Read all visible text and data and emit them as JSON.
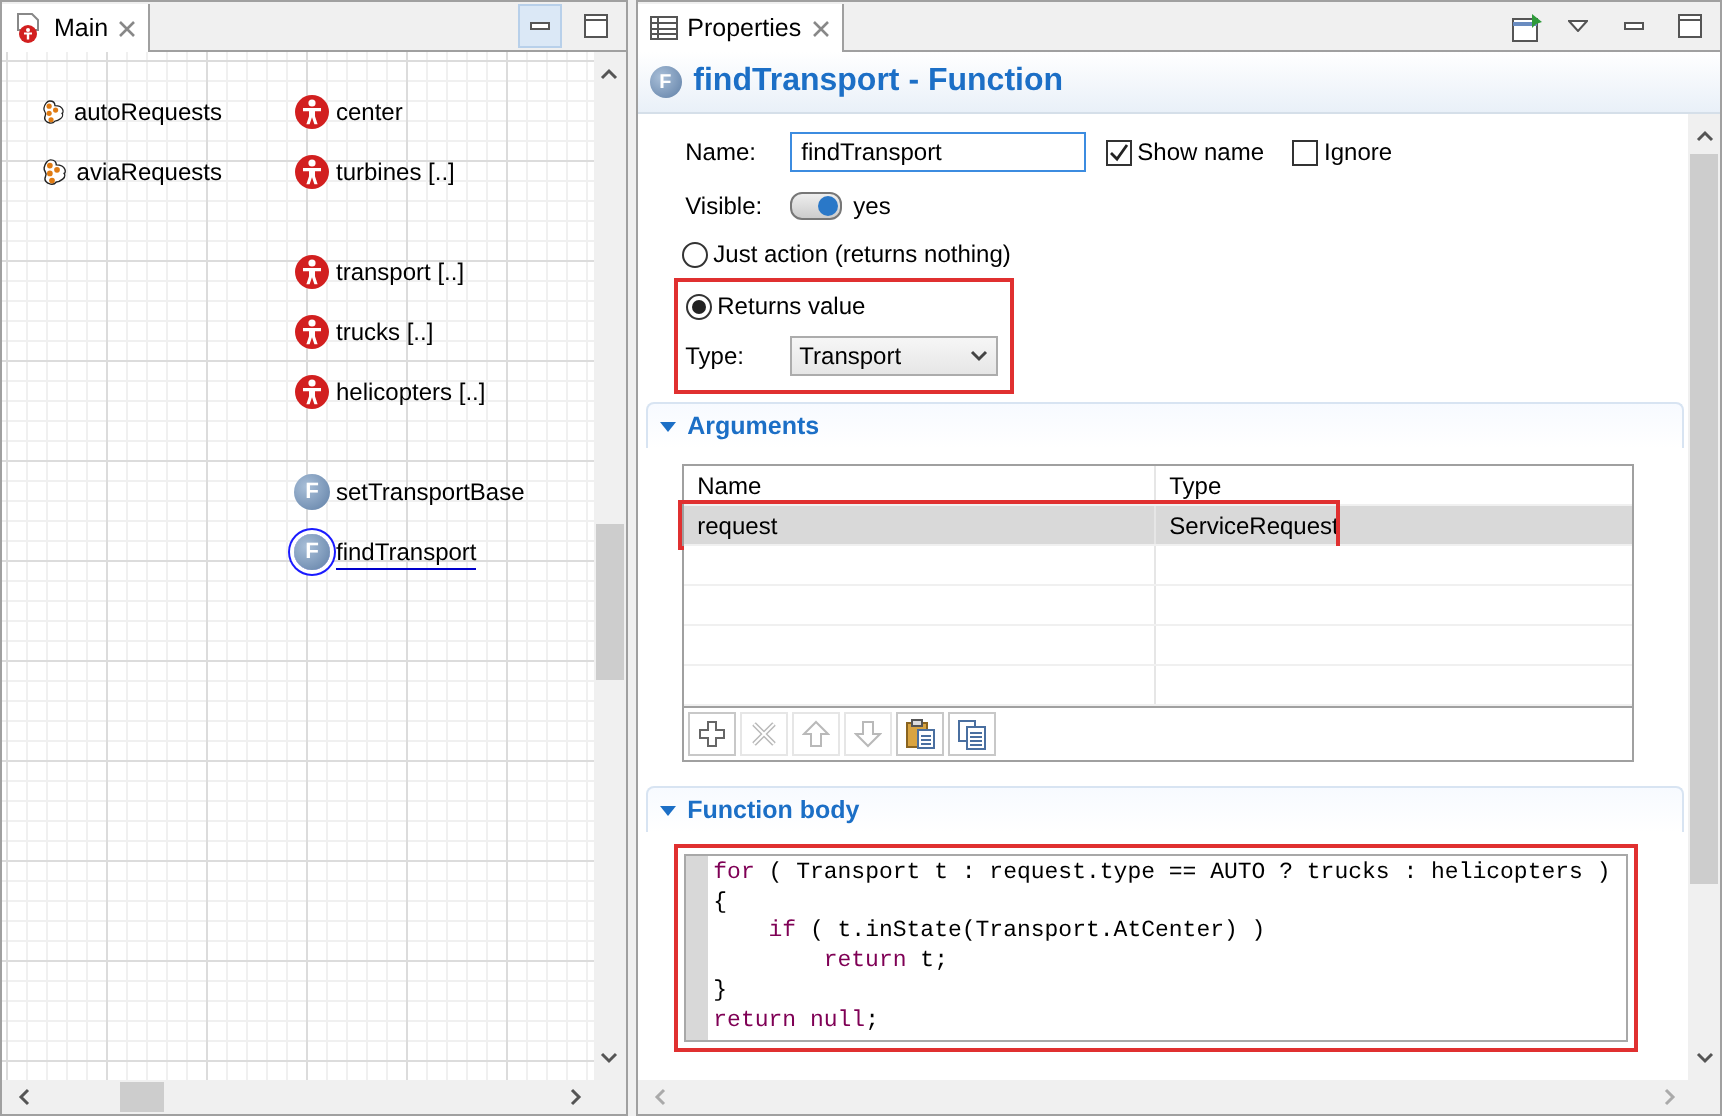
{
  "editor": {
    "tab": {
      "label": "Main",
      "selected": true
    },
    "columns": [
      [
        [
          {
            "kind": "collection",
            "label": "autoRequests",
            "selected": false
          },
          {
            "kind": "collection",
            "label": "aviaRequests",
            "selected": false
          }
        ]
      ],
      [
        [
          {
            "kind": "agent",
            "label": "center",
            "selected": false
          },
          {
            "kind": "agent",
            "label": "turbines [..]",
            "selected": false
          }
        ],
        [
          {
            "kind": "agent",
            "label": "transport [..]",
            "selected": false
          },
          {
            "kind": "agent",
            "label": "trucks [..]",
            "selected": false
          },
          {
            "kind": "agent",
            "label": "helicopters [..]",
            "selected": false
          }
        ],
        [
          {
            "kind": "function",
            "icon_letter": "F",
            "label": "setTransportBase",
            "selected": false
          },
          {
            "kind": "function",
            "icon_letter": "F",
            "label": "findTransport",
            "selected": true
          }
        ]
      ]
    ]
  },
  "properties": {
    "tab": {
      "label": "Properties",
      "selected": true
    },
    "header": {
      "icon_letter": "F",
      "title": "findTransport - Function"
    },
    "name": {
      "label": "Name:",
      "value": "findTransport"
    },
    "show_name": {
      "label": "Show name",
      "checked": true
    },
    "ignore": {
      "label": "Ignore",
      "checked": false
    },
    "visible": {
      "label": "Visible:",
      "on": true,
      "text": "yes"
    },
    "modes": [
      {
        "label": "Just action (returns nothing)",
        "selected": false
      },
      {
        "label": "Returns value",
        "selected": true,
        "highlighted": true
      }
    ],
    "type": {
      "label": "Type:",
      "value": "Transport"
    },
    "arguments": {
      "title": "Arguments",
      "expanded": true,
      "columns": [
        "Name",
        "Type"
      ],
      "rows": [
        {
          "cells": [
            "request",
            "ServiceRequest"
          ],
          "selected": true,
          "highlighted": true
        }
      ],
      "toolbar": [
        {
          "kind": "add",
          "disabled": false
        },
        {
          "kind": "remove",
          "disabled": true
        },
        {
          "kind": "up",
          "disabled": true
        },
        {
          "kind": "down",
          "disabled": true
        },
        {
          "kind": "paste",
          "disabled": false
        },
        {
          "kind": "copy",
          "disabled": false
        }
      ]
    },
    "function_body": {
      "title": "Function body",
      "expanded": true,
      "highlighted": true,
      "lines": [
        [
          {
            "kind": "keyword",
            "text": "for"
          },
          {
            "kind": "plain",
            "text": " ( Transport t : request.type == AUTO ? trucks : helicopters )"
          }
        ],
        [
          {
            "kind": "plain",
            "text": "{"
          }
        ],
        [
          {
            "kind": "keyword",
            "text": "    if"
          },
          {
            "kind": "plain",
            "text": " ( t.inState(Transport.AtCenter) )"
          }
        ],
        [
          {
            "kind": "keyword",
            "text": "        return"
          },
          {
            "kind": "plain",
            "text": " t;"
          }
        ],
        [
          {
            "kind": "plain",
            "text": "}"
          }
        ],
        [
          {
            "kind": "keyword",
            "text": "return null"
          },
          {
            "kind": "plain",
            "text": ";"
          }
        ]
      ]
    }
  }
}
